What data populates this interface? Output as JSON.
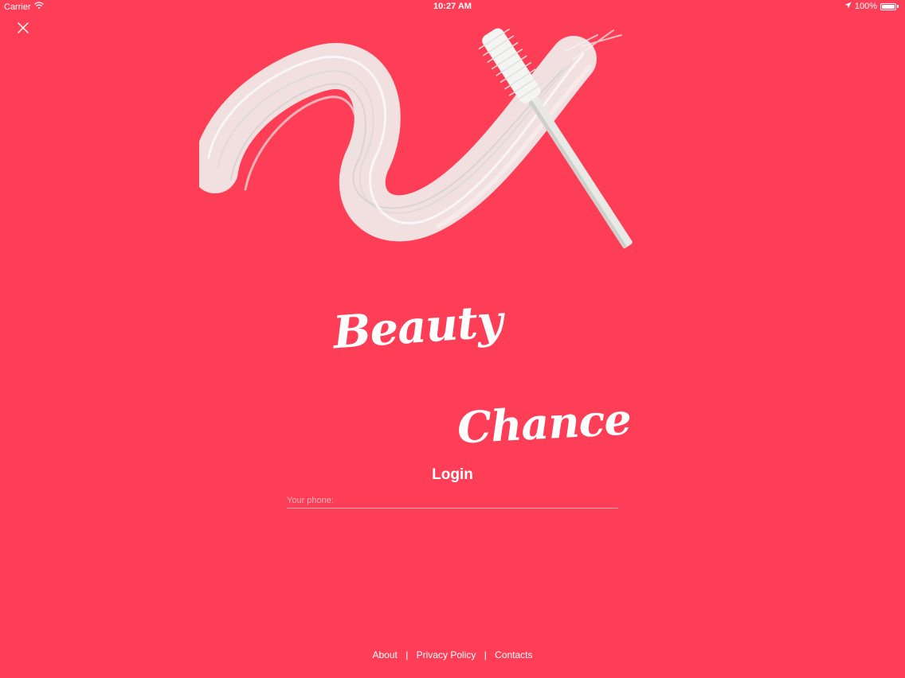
{
  "status_bar": {
    "carrier": "Carrier",
    "time": "10:27 AM",
    "battery": "100%",
    "battery_level": 1.0,
    "icons": [
      "wifi-icon",
      "location-arrow-icon",
      "battery-icon"
    ]
  },
  "close_icon": "close-icon",
  "brand": {
    "line1": "Beauty",
    "line2": "Chance"
  },
  "login": {
    "title": "Login",
    "phone_placeholder": "Your phone:",
    "phone_value": ""
  },
  "footer": {
    "links": [
      "About",
      "Privacy Policy",
      "Contacts"
    ],
    "separator": "|"
  },
  "colors": {
    "background": "#fd3e56",
    "text": "#ffffff"
  }
}
